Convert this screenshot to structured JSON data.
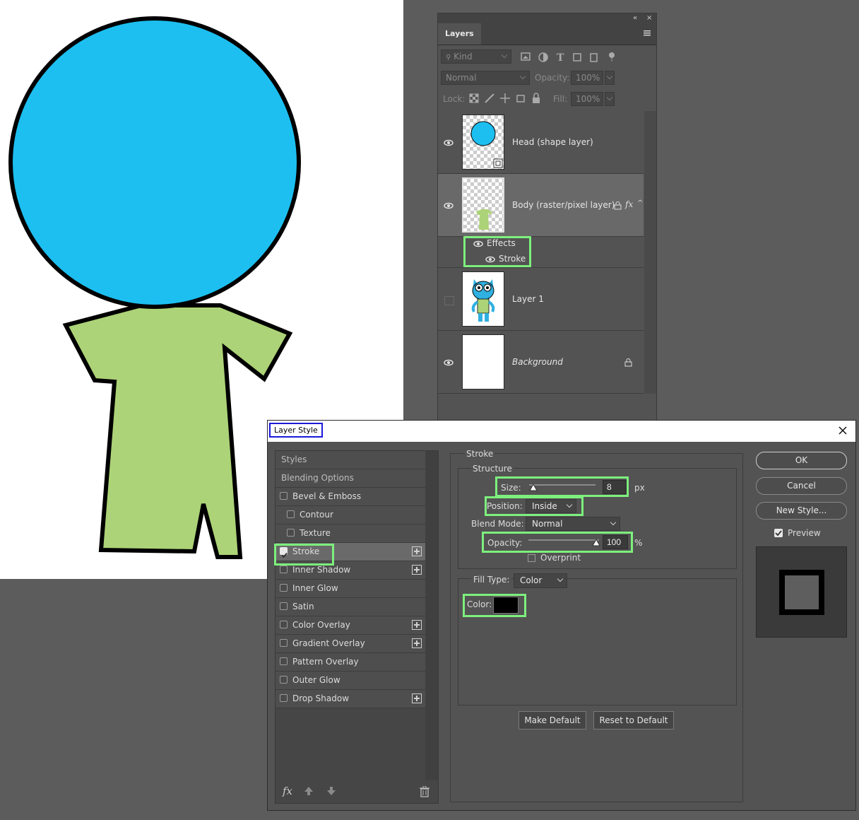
{
  "layers_panel": {
    "tab_label": "Layers",
    "filter": {
      "kind_label": "Kind"
    },
    "blend_mode": "Normal",
    "opacity_label": "Opacity:",
    "opacity_value": "100%",
    "lock_label": "Lock:",
    "fill_label": "Fill:",
    "fill_value": "100%",
    "layers": [
      {
        "name": "Head (shape layer)",
        "visible": true
      },
      {
        "name": "Body (raster/pixel layer)",
        "visible": true,
        "selected": true,
        "fx": "fx",
        "effects_label": "Effects",
        "effect_items": [
          "Stroke"
        ]
      },
      {
        "name": "Layer 1",
        "visible": false
      },
      {
        "name": "Background",
        "visible": true,
        "locked": true
      }
    ]
  },
  "dialog": {
    "title": "Layer Style",
    "styles_list": [
      {
        "label": "Styles",
        "type": "header"
      },
      {
        "label": "Blending Options",
        "type": "header"
      },
      {
        "label": "Bevel & Emboss",
        "checked": false
      },
      {
        "label": "Contour",
        "checked": false,
        "indent": true
      },
      {
        "label": "Texture",
        "checked": false,
        "indent": true
      },
      {
        "label": "Stroke",
        "checked": true,
        "plus": true,
        "selected": true
      },
      {
        "label": "Inner Shadow",
        "checked": false,
        "plus": true
      },
      {
        "label": "Inner Glow",
        "checked": false
      },
      {
        "label": "Satin",
        "checked": false
      },
      {
        "label": "Color Overlay",
        "checked": false,
        "plus": true
      },
      {
        "label": "Gradient Overlay",
        "checked": false,
        "plus": true
      },
      {
        "label": "Pattern Overlay",
        "checked": false
      },
      {
        "label": "Outer Glow",
        "checked": false
      },
      {
        "label": "Drop Shadow",
        "checked": false,
        "plus": true
      }
    ],
    "fx_label": "fx",
    "stroke": {
      "section_title": "Stroke",
      "structure_title": "Structure",
      "size_label": "Size:",
      "size_value": "8",
      "size_unit": "px",
      "position_label": "Position:",
      "position_value": "Inside",
      "blend_mode_label": "Blend Mode:",
      "blend_mode_value": "Normal",
      "opacity_label": "Opacity:",
      "opacity_value": "100",
      "opacity_unit": "%",
      "overprint_label": "Overprint",
      "fill_type_label": "Fill Type:",
      "fill_type_value": "Color",
      "color_label": "Color:",
      "color_value": "#000000"
    },
    "make_default_label": "Make Default",
    "reset_default_label": "Reset to Default",
    "ok_label": "OK",
    "cancel_label": "Cancel",
    "new_style_label": "New Style...",
    "preview_label": "Preview",
    "preview_checked": true
  },
  "colors": {
    "head_fill": "#1dbff0",
    "body_fill": "#acd377",
    "highlight": "#7df07d",
    "title_highlight": "#1a1ad8"
  }
}
